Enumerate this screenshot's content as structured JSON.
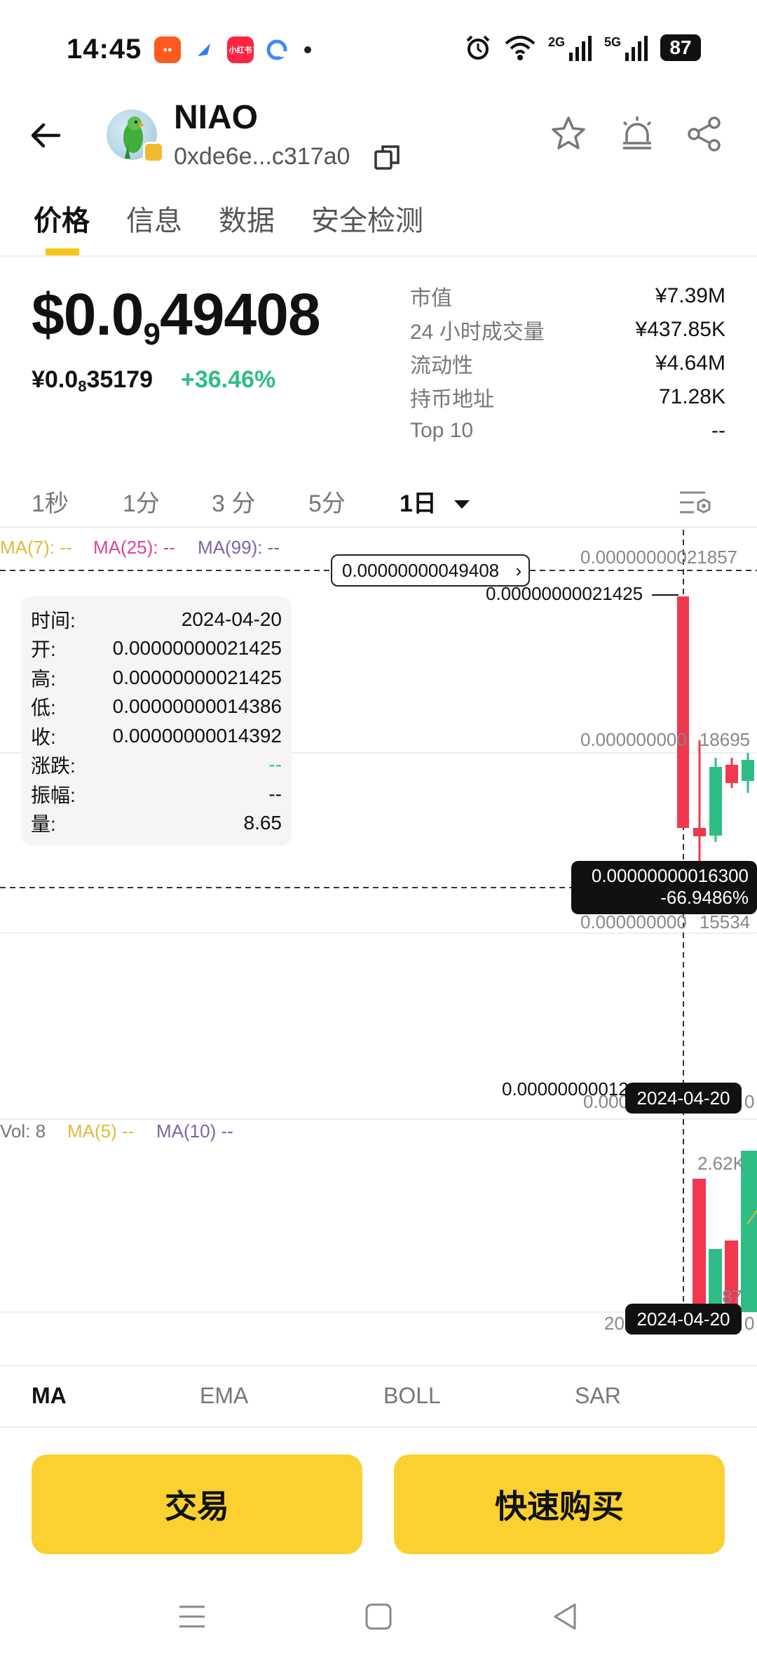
{
  "status_bar": {
    "time": "14:45",
    "battery": "87",
    "signal_2g": "2G",
    "signal_5g": "5G",
    "app_icons": [
      "kuaishou-icon",
      "blue-app-icon",
      "xiaohongshu-icon",
      "browser-icon"
    ],
    "xiaohongshu_label": "小红书"
  },
  "header": {
    "token_name": "NIAO",
    "address": "0xde6e...c317a0"
  },
  "tabs": [
    "价格",
    "信息",
    "数据",
    "安全检测"
  ],
  "price": {
    "main_prefix": "$0.0",
    "main_sub": "9",
    "main_suffix": "49408",
    "cny_prefix": "¥0.0",
    "cny_sub": "8",
    "cny_suffix": "35179",
    "change": "+36.46%"
  },
  "stats": [
    {
      "label": "市值",
      "value": "¥7.39M"
    },
    {
      "label": "24 小时成交量",
      "value": "¥437.85K"
    },
    {
      "label": "流动性",
      "value": "¥4.64M"
    },
    {
      "label": "持币地址",
      "value": "71.28K"
    },
    {
      "label": "Top 10",
      "value": "--"
    }
  ],
  "intervals": [
    "1秒",
    "1分",
    "3 分",
    "5分",
    "1日"
  ],
  "chart": {
    "ma7": "MA(7): --",
    "ma25": "MA(25): --",
    "ma99": "MA(99): --",
    "price_flag": "0.00000000049408",
    "axis_top": "0.00000000021857",
    "axis_mid": "0.000000000",
    "axis_mid_tail": "18695",
    "axis_low": "0.000000000",
    "axis_low_tail": "15534",
    "axis_bottom_partial": "0.000",
    "axis_bottom_tail": "0",
    "high_label": "0.00000000021425",
    "low_label": "0.00000000012",
    "crosshair_value": "0.00000000016300",
    "crosshair_pct": "-66.9486%",
    "date_chip": "2024-04-20",
    "vol_label": "Vol: 8",
    "vol_ma5": "MA(5) --",
    "vol_ma10": "MA(10) --",
    "vol_axis_top": "2.62K",
    "vol_axis_tail": "87",
    "vol_axis_left": "20",
    "vol_axis_right": "0",
    "vol_date_chip": "2024-04-20"
  },
  "tooltip": [
    {
      "label": "时间:",
      "value": "2024-04-20"
    },
    {
      "label": "开:",
      "value": "0.00000000021425"
    },
    {
      "label": "高:",
      "value": "0.00000000021425"
    },
    {
      "label": "低:",
      "value": "0.00000000014386"
    },
    {
      "label": "收:",
      "value": "0.00000000014392"
    },
    {
      "label": "涨跌:",
      "value": "--"
    },
    {
      "label": "振幅:",
      "value": "--"
    },
    {
      "label": "量:",
      "value": "8.65"
    }
  ],
  "indicators": [
    "MA",
    "EMA",
    "BOLL",
    "SAR"
  ],
  "buttons": {
    "trade": "交易",
    "quick_buy": "快速购买"
  },
  "colors": {
    "accent": "#fad130",
    "up": "#2ebd85",
    "down": "#f0384f"
  }
}
